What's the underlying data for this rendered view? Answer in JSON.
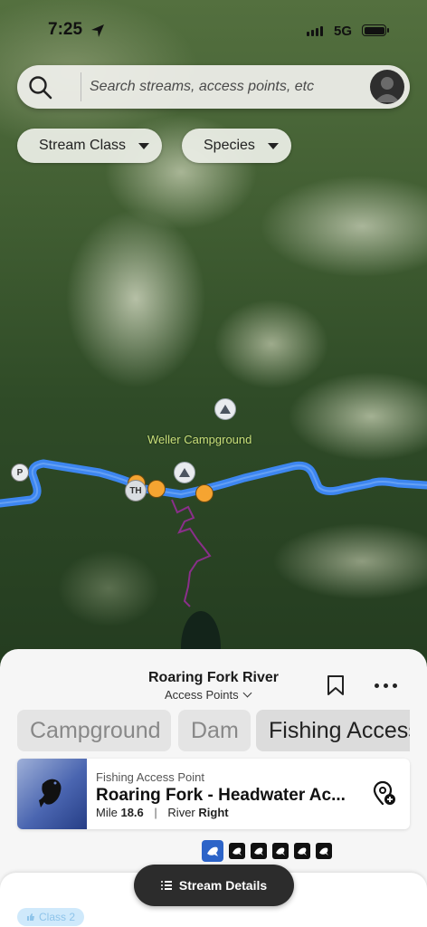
{
  "status_bar": {
    "time": "7:25",
    "network": "5G"
  },
  "search": {
    "placeholder": "Search streams, access points, etc"
  },
  "filters": [
    {
      "label": "Stream Class"
    },
    {
      "label": "Species"
    }
  ],
  "map": {
    "campground_label": "Weller Campground",
    "trailhead_label": "TH",
    "parking_label": "P"
  },
  "sheet": {
    "title": "Roaring Fork River",
    "subtitle": "Access Points",
    "tabs": [
      "Campground",
      "Dam",
      "Fishing Access"
    ],
    "active_tab": "Fishing Access",
    "card": {
      "type": "Fishing Access Point",
      "name": "Roaring Fork - Headwater Ac...",
      "mile_label": "Mile",
      "mile_value": "18.6",
      "side_label": "River",
      "side_value": "Right"
    }
  },
  "stream_details_button": "Stream Details",
  "class_badge": "Class 2",
  "colors": {
    "river": "#3d86f0",
    "access_pin": "#f5a431",
    "trail": "#8a2f8a",
    "species_selected": "#2d64c8"
  }
}
